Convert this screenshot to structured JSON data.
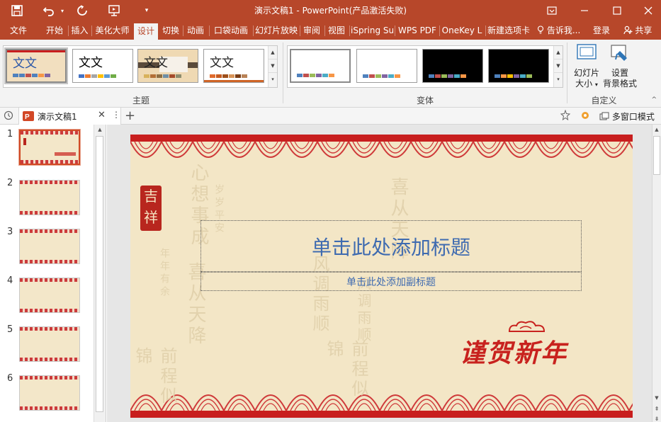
{
  "app": {
    "window_title": "演示文稿1 - PowerPoint(产品激活失败)"
  },
  "quick_access": {
    "save_icon": "save-icon",
    "undo_icon": "undo-icon",
    "redo_icon": "redo-icon",
    "present_icon": "slideshow-icon",
    "customize_icon": "customize-qat-icon"
  },
  "ribbon_tabs": [
    {
      "label": "文件"
    },
    {
      "label": "开始"
    },
    {
      "label": "插入"
    },
    {
      "label": "美化大师"
    },
    {
      "label": "设计"
    },
    {
      "label": "切换"
    },
    {
      "label": "动画"
    },
    {
      "label": "口袋动画"
    },
    {
      "label": "幻灯片放映"
    },
    {
      "label": "审阅"
    },
    {
      "label": "视图"
    },
    {
      "label": "iSpring Su"
    },
    {
      "label": "WPS PDF"
    },
    {
      "label": "OneKey L"
    },
    {
      "label": "新建选项卡"
    }
  ],
  "active_tab": "设计",
  "tell_me": "告诉我...",
  "login": "登录",
  "share": "共享",
  "ribbon": {
    "themes_label": "主题",
    "theme_sample_text": "文文",
    "variants_label": "变体",
    "customize_label": "自定义",
    "slide_size_line1": "幻灯片",
    "slide_size_line2": "大小",
    "format_bg_line1": "设置",
    "format_bg_line2": "背景格式"
  },
  "colors": {
    "accent": "#b7472a",
    "title_blue": "#3f6bb0",
    "festive_red": "#c8221e"
  },
  "doc_tab": {
    "name": "演示文稿1",
    "multi_window": "多窗口模式"
  },
  "slides": [
    {
      "number": "1"
    },
    {
      "number": "2"
    },
    {
      "number": "3"
    },
    {
      "number": "4"
    },
    {
      "number": "5"
    },
    {
      "number": "6"
    }
  ],
  "slide": {
    "title_placeholder": "单击此处添加标题",
    "subtitle_placeholder": "单击此处添加副标题",
    "seal_text": "吉祥",
    "greeting": "谨贺新年",
    "ghost_1": "心想事成",
    "ghost_2": "岁岁平安",
    "ghost_3": "年年有余",
    "ghost_4": "喜从天降",
    "ghost_5": "风调雨顺",
    "ghost_6": "前程似锦"
  }
}
